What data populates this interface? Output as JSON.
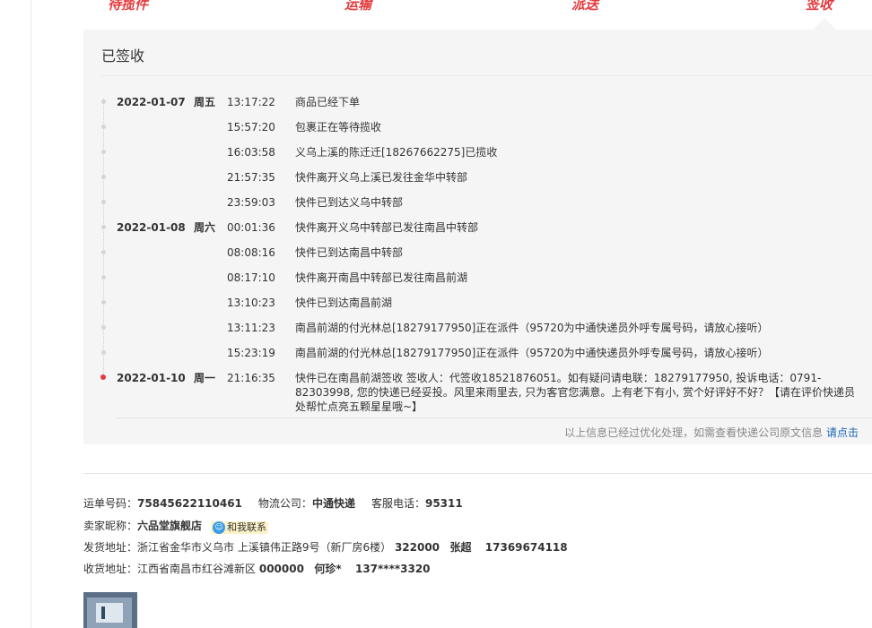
{
  "progress": {
    "steps": [
      "待揽件",
      "运输",
      "派送",
      "签收"
    ]
  },
  "tracking": {
    "status_title": "已签收",
    "events": [
      {
        "date": "2022-01-07",
        "weekday": "周五",
        "time": "13:17:22",
        "desc": "商品已经下单"
      },
      {
        "date": "",
        "weekday": "",
        "time": "15:57:20",
        "desc": "包裹正在等待揽收"
      },
      {
        "date": "",
        "weekday": "",
        "time": "16:03:58",
        "desc": "义乌上溪的陈迁迁[18267662275]已揽收"
      },
      {
        "date": "",
        "weekday": "",
        "time": "21:57:35",
        "desc": "快件离开义乌上溪已发往金华中转部"
      },
      {
        "date": "",
        "weekday": "",
        "time": "23:59:03",
        "desc": "快件已到达义乌中转部"
      },
      {
        "date": "2022-01-08",
        "weekday": "周六",
        "time": "00:01:36",
        "desc": "快件离开义乌中转部已发往南昌中转部"
      },
      {
        "date": "",
        "weekday": "",
        "time": "08:08:16",
        "desc": "快件已到达南昌中转部"
      },
      {
        "date": "",
        "weekday": "",
        "time": "08:17:10",
        "desc": "快件离开南昌中转部已发往南昌前湖"
      },
      {
        "date": "",
        "weekday": "",
        "time": "13:10:23",
        "desc": "快件已到达南昌前湖"
      },
      {
        "date": "",
        "weekday": "",
        "time": "13:11:23",
        "desc": "南昌前湖的付光林总[18279177950]正在派件（95720为中通快递员外呼专属号码，请放心接听）"
      },
      {
        "date": "",
        "weekday": "",
        "time": "15:23:19",
        "desc": "南昌前湖的付光林总[18279177950]正在派件（95720为中通快递员外呼专属号码，请放心接听）"
      },
      {
        "date": "2022-01-10",
        "weekday": "周一",
        "time": "21:16:35",
        "desc": "快件已在南昌前湖签收 签收人：代签收18521876051。如有疑问请电联：18279177950, 投诉电话：0791-82303998, 您的快递已经妥投。风里来雨里去, 只为客官您满意。上有老下有小, 赏个好评好不好？【请在评价快递员处帮忙点亮五颗星星哦~】"
      }
    ],
    "note_text": "以上信息已经过优化处理，如需查看快递公司原文信息",
    "note_link": "请点击"
  },
  "shipment": {
    "waybill_label": "运单号码：",
    "waybill_no": "75845622110461",
    "carrier_label": "物流公司：",
    "carrier": "中通快递",
    "hotline_label": "客服电话：",
    "hotline": "95311",
    "seller_label": "卖家昵称：",
    "seller": "六品堂旗舰店",
    "contact_label": "和我联系",
    "from_label": "发货地址：",
    "from_address": "浙江省金华市义乌市 上溪镇伟正路9号（新厂房6楼）",
    "from_zip": "322000",
    "from_name": "张超",
    "from_phone": "17369674118",
    "to_label": "收货地址：",
    "to_address": "江西省南昌市红谷滩新区",
    "to_zip": "000000",
    "to_name": "何珍*",
    "to_phone": "137****3320"
  },
  "colors": {
    "accent": "#e4393c",
    "link": "#1a66b3",
    "panel_bg": "#f5f5f5"
  }
}
